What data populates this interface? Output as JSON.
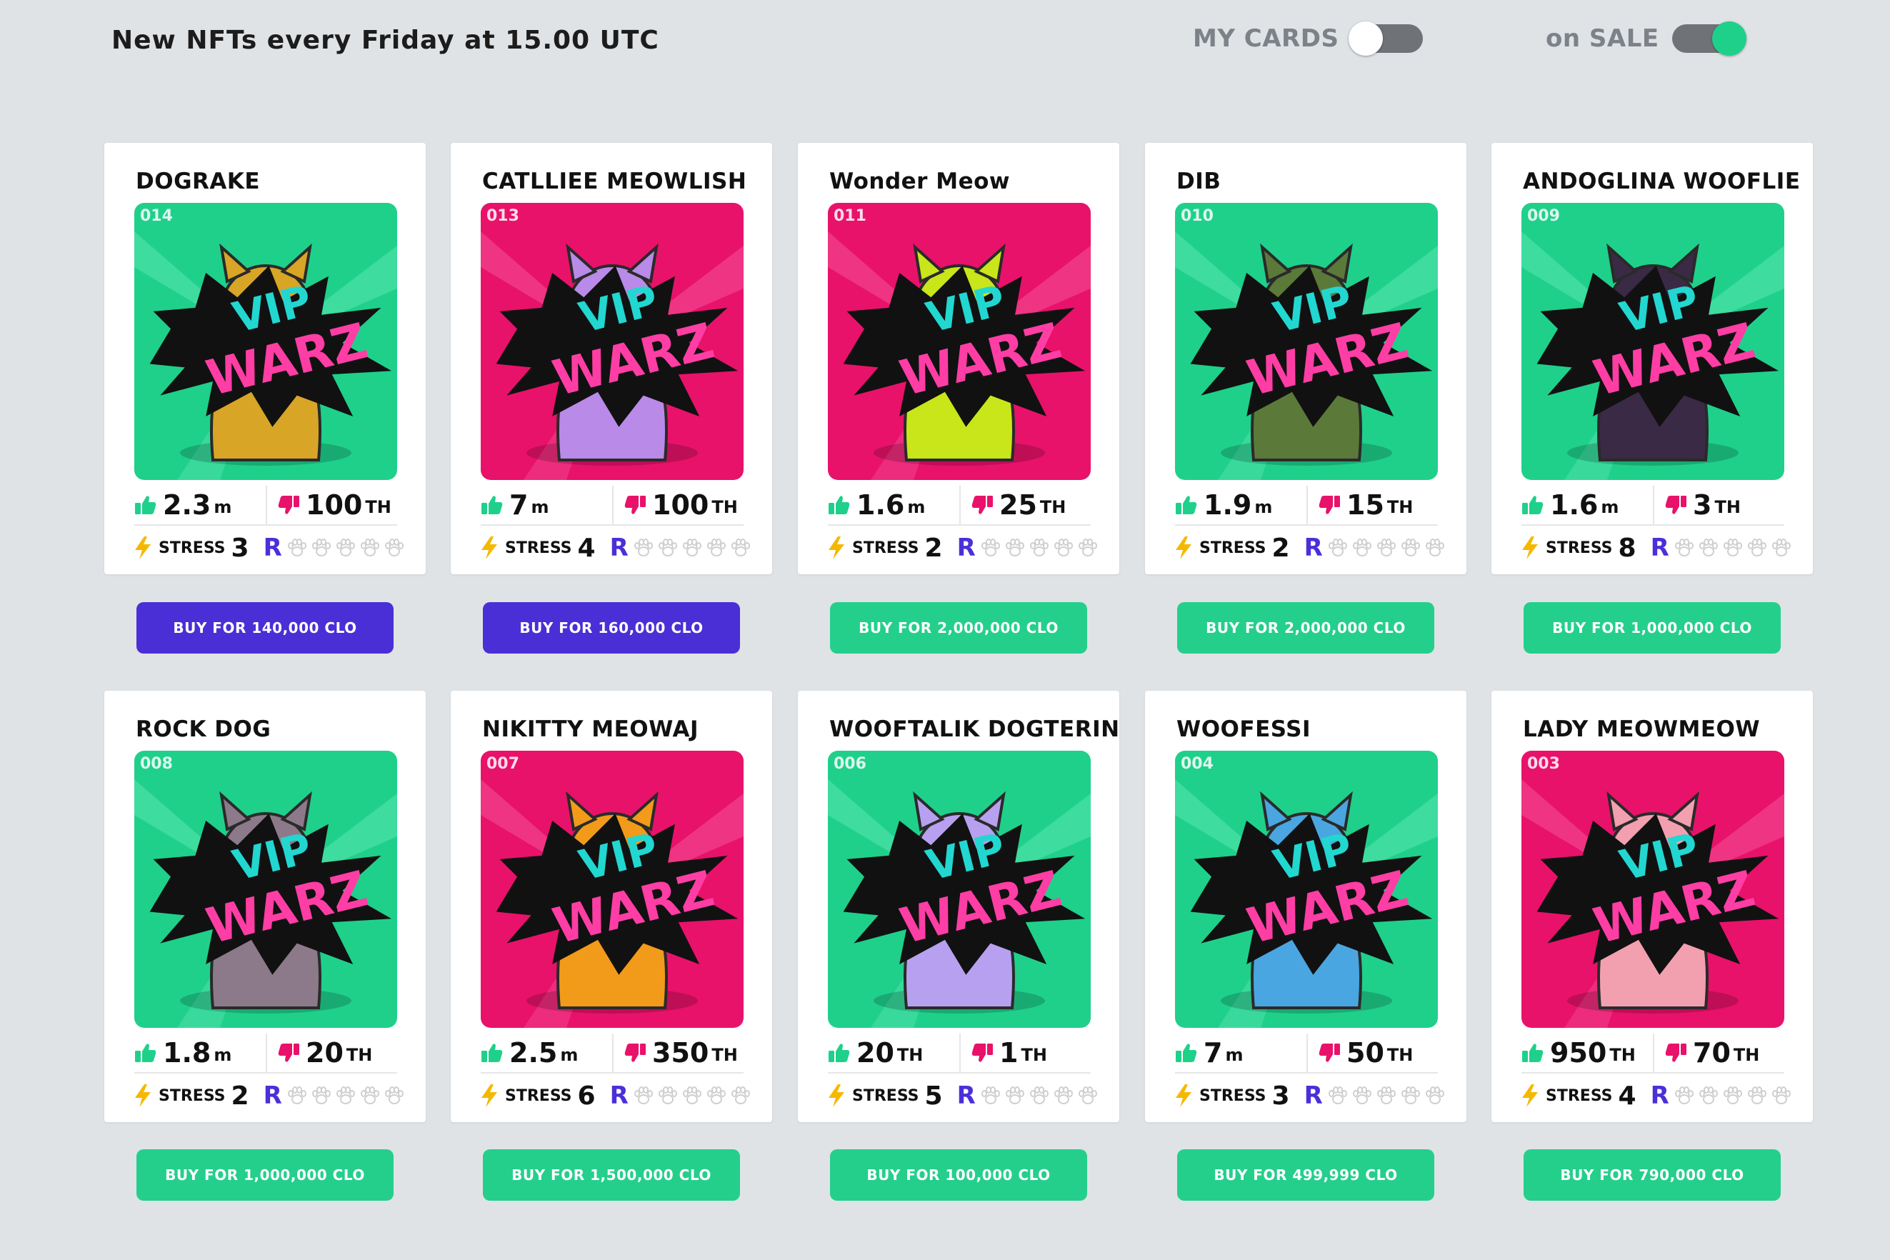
{
  "header": {
    "title": "New NFTs every Friday at 15.00 UTC",
    "my_cards_label": "MY CARDS",
    "my_cards_on": false,
    "on_sale_label": "on SALE",
    "on_sale_on": true
  },
  "colors": {
    "green": "#1fd08b",
    "pink": "#e8126a",
    "purple": "#4a2fd6",
    "button_green": "#24cf8c"
  },
  "badge_text": [
    "VIP",
    "WARZ"
  ],
  "stress_label": "STRESS",
  "rarity_label": "R",
  "cards": [
    {
      "name": "DOGRAKE",
      "number": "014",
      "bg": "green",
      "likes": "2.3",
      "likes_unit": "m",
      "dislikes": "100",
      "dislikes_unit": "TH",
      "stress": "3",
      "button": "BUY FOR 140,000 CLO",
      "button_color": "purple",
      "art_icon": "dog-rapper-icon"
    },
    {
      "name": "CATLLIEE MEOWLISH",
      "number": "013",
      "bg": "pink",
      "likes": "7",
      "likes_unit": "m",
      "dislikes": "100",
      "dislikes_unit": "TH",
      "stress": "4",
      "button": "BUY FOR 160,000 CLO",
      "button_color": "purple",
      "art_icon": "cat-singer-icon"
    },
    {
      "name": "Wonder Meow",
      "number": "011",
      "bg": "pink",
      "likes": "1.6",
      "likes_unit": "m",
      "dislikes": "25",
      "dislikes_unit": "TH",
      "stress": "2",
      "button": "BUY FOR 2,000,000 CLO",
      "button_color": "green",
      "art_icon": "cat-hero-icon"
    },
    {
      "name": "DIB",
      "number": "010",
      "bg": "green",
      "likes": "1.9",
      "likes_unit": "m",
      "dislikes": "15",
      "dislikes_unit": "TH",
      "stress": "2",
      "button": "BUY FOR 2,000,000 CLO",
      "button_color": "green",
      "art_icon": "dog-agent-icon"
    },
    {
      "name": "ANDOGLINA WOOFLIE",
      "number": "009",
      "bg": "green",
      "likes": "1.6",
      "likes_unit": "m",
      "dislikes": "3",
      "dislikes_unit": "TH",
      "stress": "8",
      "button": "BUY FOR 1,000,000 CLO",
      "button_color": "green",
      "art_icon": "dog-witch-icon"
    },
    {
      "name": "ROCK DOG",
      "number": "008",
      "bg": "green",
      "likes": "1.8",
      "likes_unit": "m",
      "dislikes": "20",
      "dislikes_unit": "TH",
      "stress": "2",
      "button": "BUY FOR 1,000,000 CLO",
      "button_color": "green",
      "art_icon": "dog-wrestler-icon"
    },
    {
      "name": "NIKITTY MEOWAJ",
      "number": "007",
      "bg": "pink",
      "likes": "2.5",
      "likes_unit": "m",
      "dislikes": "350",
      "dislikes_unit": "TH",
      "stress": "6",
      "button": "BUY FOR 1,500,000 CLO",
      "button_color": "green",
      "art_icon": "cat-diva-icon"
    },
    {
      "name": "WOOFTALIK DOGTERIN",
      "number": "006",
      "bg": "green",
      "likes": "20",
      "likes_unit": "TH",
      "dislikes": "1",
      "dislikes_unit": "TH",
      "stress": "5",
      "button": "BUY FOR 100,000 CLO",
      "button_color": "green",
      "art_icon": "dog-crypto-icon"
    },
    {
      "name": "WOOFESSI",
      "number": "004",
      "bg": "green",
      "likes": "7",
      "likes_unit": "m",
      "dislikes": "50",
      "dislikes_unit": "TH",
      "stress": "3",
      "button": "BUY FOR 499,999 CLO",
      "button_color": "green",
      "art_icon": "dog-footballer-icon"
    },
    {
      "name": "LADY MEOWMEOW",
      "number": "003",
      "bg": "pink",
      "likes": "950",
      "likes_unit": "TH",
      "dislikes": "70",
      "dislikes_unit": "TH",
      "stress": "4",
      "button": "BUY FOR 790,000 CLO",
      "button_color": "green",
      "art_icon": "cat-popstar-icon"
    }
  ]
}
